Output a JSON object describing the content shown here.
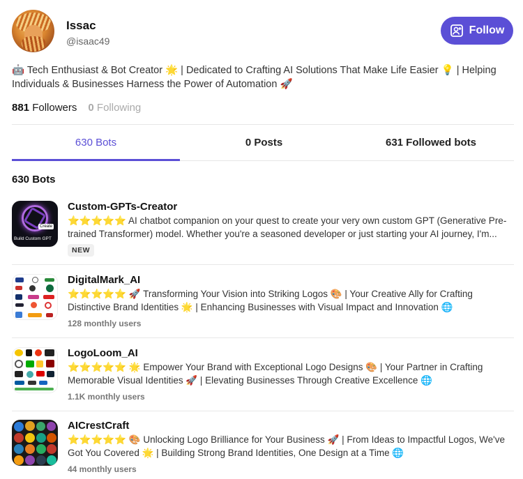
{
  "profile": {
    "name": "Issac",
    "handle": "@isaac49",
    "follow_label": "Follow",
    "bio": "🤖 Tech Enthusiast & Bot Creator 🌟 | Dedicated to Crafting AI Solutions That Make Life Easier 💡 | Helping Individuals & Businesses Harness the Power of Automation 🚀",
    "followers_count": "881",
    "followers_label": "Followers",
    "following_count": "0",
    "following_label": "Following"
  },
  "tabs": [
    {
      "label": "630 Bots"
    },
    {
      "label": "0 Posts"
    },
    {
      "label": "631 Followed bots"
    }
  ],
  "section_title": "630 Bots",
  "bots": [
    {
      "name": "Custom-GPTs-Creator",
      "description": "⭐⭐⭐⭐⭐ AI chatbot companion on your quest to create your very own custom GPT (Generative Pre-trained Transformer) model. Whether you're a seasoned developer or just starting your AI journey, I'm...",
      "meta": "NEW",
      "thumb_caption": "Build Custom GPT",
      "thumb_button": "Create"
    },
    {
      "name": "DigitalMark_AI",
      "description": "⭐⭐⭐⭐⭐ 🚀 Transforming Your Vision into Striking Logos 🎨 | Your Creative Ally for Crafting Distinctive Brand Identities 🌟 | Enhancing Businesses with Visual Impact and Innovation 🌐",
      "meta": "128 monthly users"
    },
    {
      "name": "LogoLoom_AI",
      "description": "⭐⭐⭐⭐⭐ 🌟 Empower Your Brand with Exceptional Logo Designs 🎨 | Your Partner in Crafting Memorable Visual Identities 🚀 | Elevating Businesses Through Creative Excellence 🌐",
      "meta": "1.1K monthly users"
    },
    {
      "name": "AICrestCraft",
      "description": "⭐⭐⭐⭐⭐ 🎨 Unlocking Logo Brilliance for Your Business 🚀 | From Ideas to Impactful Logos, We've Got You Covered 🌟 | Building Strong Brand Identities, One Design at a Time 🌐",
      "meta": "44 monthly users"
    }
  ],
  "colors": {
    "accent": "#5b4fd6",
    "muted": "#aaaaaa"
  }
}
